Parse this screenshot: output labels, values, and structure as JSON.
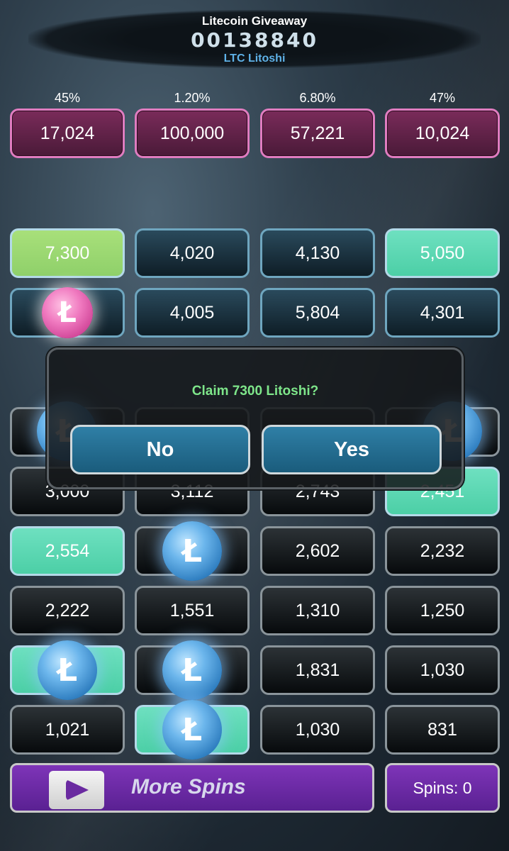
{
  "header": {
    "title": "Litecoin Giveaway",
    "counter": "00138840",
    "subtitle": "LTC Litoshi"
  },
  "prizes": [
    {
      "percent": "45%",
      "value": "17,024"
    },
    {
      "percent": "1.20%",
      "value": "100,000"
    },
    {
      "percent": "6.80%",
      "value": "57,221"
    },
    {
      "percent": "47%",
      "value": "10,024"
    }
  ],
  "grid": {
    "row1": [
      "7,300",
      "4,020",
      "4,130",
      "5,050"
    ],
    "row2": [
      "",
      "4,005",
      "5,804",
      "4,301"
    ],
    "row4": [
      "3,000",
      "3,112",
      "2,743",
      "2,451"
    ],
    "row5": [
      "2,554",
      "",
      "2,602",
      "2,232"
    ],
    "row6": [
      "2,222",
      "1,551",
      "1,310",
      "1,250"
    ],
    "row7": [
      "",
      "",
      "1,831",
      "1,030"
    ],
    "row8": [
      "1,021",
      "",
      "1,030",
      "831"
    ]
  },
  "coin_symbol": "Ł",
  "dialog": {
    "message": "Claim 7300 Litoshi?",
    "no_label": "No",
    "yes_label": "Yes"
  },
  "bottom": {
    "more_spins_label": "More Spins",
    "spins_label": "Spins: 0"
  },
  "colors": {
    "prize_border": "#e07cc0",
    "tile_green": "#a8e07a",
    "tile_teal": "#6ee0c0",
    "dialog_text": "#7ee68a",
    "button_blue": "#2f7fa6",
    "spins_purple": "#7e34b8"
  }
}
